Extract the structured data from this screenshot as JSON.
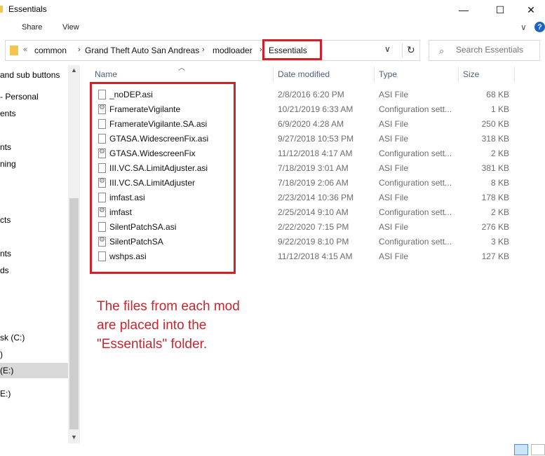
{
  "window": {
    "title": "Essentials",
    "minimize_glyph": "—",
    "maximize_glyph": "☐",
    "close_glyph": "✕"
  },
  "ribbon": {
    "tabs": [
      "Share",
      "View"
    ],
    "collapse_glyph": "∨",
    "help_glyph": "?"
  },
  "address_bar": {
    "prefix": "«",
    "crumbs": [
      "common",
      "Grand Theft Auto San Andreas",
      "modloader",
      "Essentials"
    ],
    "separator": "›",
    "dropdown_glyph": "∨",
    "refresh_glyph": "↻"
  },
  "search": {
    "placeholder": "Search Essentials",
    "icon": "search-icon"
  },
  "navigation": [
    {
      "label": "and sub buttons",
      "selected": false
    },
    {
      "label": "- Personal",
      "selected": false
    },
    {
      "label": "ents",
      "selected": false
    },
    {
      "label": "nts",
      "selected": false
    },
    {
      "label": "ning",
      "selected": false
    },
    {
      "label": "cts",
      "selected": false
    },
    {
      "label": "nts",
      "selected": false
    },
    {
      "label": "ds",
      "selected": false
    },
    {
      "label": "sk (C:)",
      "selected": false
    },
    {
      "label": ")",
      "selected": false
    },
    {
      "label": "(E:)",
      "selected": true
    },
    {
      "label": "E:)",
      "selected": false
    }
  ],
  "columns": {
    "name": "Name",
    "date": "Date modified",
    "type": "Type",
    "size": "Size"
  },
  "files": [
    {
      "name": "_noDEP.asi",
      "date": "2/8/2016 6:20 PM",
      "type": "ASI File",
      "size": "68 KB",
      "icon": "asi-file-icon"
    },
    {
      "name": "FramerateVigilante",
      "date": "10/21/2019 6:33 AM",
      "type": "Configuration sett...",
      "size": "1 KB",
      "icon": "config-file-icon"
    },
    {
      "name": "FramerateVigilante.SA.asi",
      "date": "6/9/2020 4:28 AM",
      "type": "ASI File",
      "size": "250 KB",
      "icon": "asi-file-icon"
    },
    {
      "name": "GTASA.WidescreenFix.asi",
      "date": "9/27/2018 10:53 PM",
      "type": "ASI File",
      "size": "318 KB",
      "icon": "asi-file-icon"
    },
    {
      "name": "GTASA.WidescreenFix",
      "date": "11/12/2018 4:17 AM",
      "type": "Configuration sett...",
      "size": "2 KB",
      "icon": "config-file-icon"
    },
    {
      "name": "III.VC.SA.LimitAdjuster.asi",
      "date": "7/18/2019 3:01 AM",
      "type": "ASI File",
      "size": "381 KB",
      "icon": "asi-file-icon"
    },
    {
      "name": "III.VC.SA.LimitAdjuster",
      "date": "7/18/2019 2:06 AM",
      "type": "Configuration sett...",
      "size": "8 KB",
      "icon": "config-file-icon"
    },
    {
      "name": "imfast.asi",
      "date": "2/23/2014 10:36 PM",
      "type": "ASI File",
      "size": "178 KB",
      "icon": "asi-file-icon"
    },
    {
      "name": "imfast",
      "date": "2/25/2014 9:10 AM",
      "type": "Configuration sett...",
      "size": "2 KB",
      "icon": "config-file-icon"
    },
    {
      "name": "SilentPatchSA.asi",
      "date": "2/22/2020 7:15 PM",
      "type": "ASI File",
      "size": "276 KB",
      "icon": "asi-file-icon"
    },
    {
      "name": "SilentPatchSA",
      "date": "9/22/2019 8:10 PM",
      "type": "Configuration sett...",
      "size": "3 KB",
      "icon": "config-file-icon"
    },
    {
      "name": "wshps.asi",
      "date": "11/12/2018 4:15 AM",
      "type": "ASI File",
      "size": "127 KB",
      "icon": "asi-file-icon"
    }
  ],
  "annotation": {
    "lines": [
      "The files from each mod",
      "are placed into the",
      "\"Essentials\" folder."
    ],
    "color": "#c8262f"
  },
  "colors": {
    "highlight_border": "#d0202a",
    "selected_nav": "#d9d9d9",
    "folder": "#f3c64b"
  }
}
